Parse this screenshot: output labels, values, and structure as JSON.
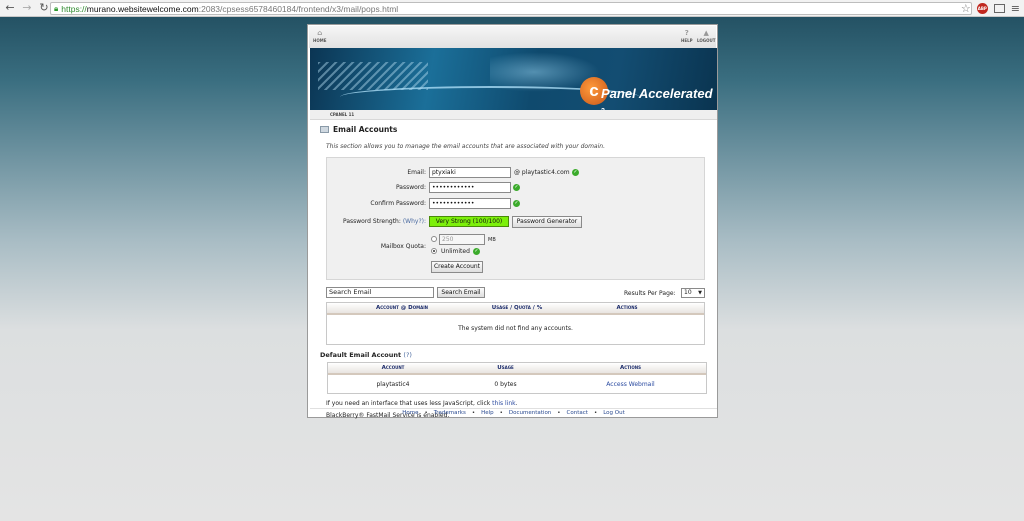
{
  "browser": {
    "url_scheme": "https://",
    "url_host": "murano.websitewelcome.com",
    "url_path": ":2083/cpsess6578460184/frontend/x3/mail/pops.html",
    "abp_label": "ABP"
  },
  "cpanel": {
    "nav": {
      "home": "HOME",
      "help": "HELP",
      "logout": "LOGOUT"
    },
    "logo_letter": "c",
    "logo_text": "Panel Accelerated",
    "logo_sub": "2",
    "breadcrumb": "CPANEL 11"
  },
  "section": {
    "title": "Email Accounts",
    "description": "This section allows you to manage the email accounts that are associated with your domain."
  },
  "form": {
    "email_label": "Email:",
    "email_value": "ptyxiaki",
    "domain": "@ playtastic4.com",
    "password_label": "Password:",
    "password_value": "••••••••••••",
    "confirm_label": "Confirm Password:",
    "confirm_value": "••••••••••••",
    "strength_label": "Password Strength:",
    "why_link": "(Why?):",
    "strength_value": "Very Strong (100/100)",
    "generator_button": "Password Generator",
    "quota_label": "Mailbox Quota:",
    "quota_value": "250",
    "quota_unit": "MB",
    "unlimited_label": "Unlimited",
    "create_button": "Create Account"
  },
  "search": {
    "input_value": "Search Email",
    "button": "Search Email",
    "results_label": "Results Per Page:",
    "results_value": "10"
  },
  "accounts_table": {
    "col_account_domain": "Account @ Domain",
    "col_usage_quota": "Usage / Quota / %",
    "col_actions": "Actions",
    "empty_message": "The system did not find any accounts."
  },
  "default_account": {
    "title": "Default Email Account",
    "help": "(?)",
    "col_account": "Account",
    "col_usage": "Usage",
    "col_actions": "Actions",
    "row_account": "playtastic4",
    "row_usage": "0 bytes",
    "row_action": "Access Webmail"
  },
  "notes": {
    "js_prefix": "If you need an interface that uses less JavaScript, click",
    "js_link": "this link",
    "js_suffix": ".",
    "blackberry": "BlackBerry® FastMail Service is enabled."
  },
  "footer": {
    "home": "Home",
    "trademarks": "Trademarks",
    "help": "Help",
    "documentation": "Documentation",
    "contact": "Contact",
    "logout": "Log Out"
  }
}
